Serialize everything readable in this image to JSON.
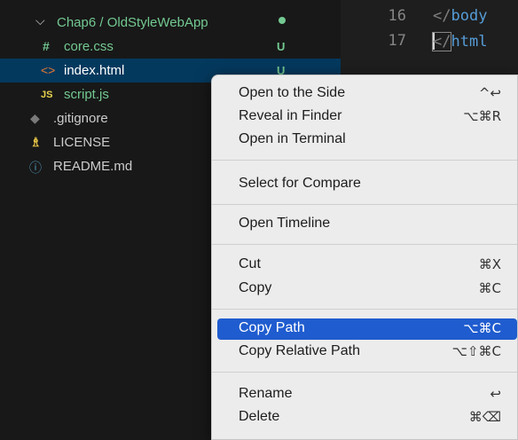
{
  "explorer": {
    "folder": {
      "label": "Chap6 / OldStyleWebApp",
      "dot_color": "#73c991"
    },
    "files": [
      {
        "icon": "#",
        "label": "core.css",
        "badge": "U"
      },
      {
        "icon": "<>",
        "label": "index.html",
        "badge": "U"
      },
      {
        "icon": "JS",
        "label": "script.js",
        "badge": ""
      },
      {
        "icon": "◆",
        "label": ".gitignore",
        "badge": ""
      },
      {
        "icon": "♗",
        "label": "LICENSE",
        "badge": ""
      },
      {
        "icon": "ⓘ",
        "label": "README.md",
        "badge": ""
      }
    ]
  },
  "editor": {
    "lines": [
      {
        "number": "16",
        "open": "</",
        "tag": "body"
      },
      {
        "number": "17",
        "open": "</",
        "tag": "html"
      }
    ]
  },
  "context_menu": {
    "items": [
      {
        "label": "Open to the Side",
        "shortcut": "^↩"
      },
      {
        "label": "Reveal in Finder",
        "shortcut": "⌥⌘R"
      },
      {
        "label": "Open in Terminal",
        "shortcut": ""
      },
      {
        "label": "Select for Compare",
        "shortcut": ""
      },
      {
        "label": "Open Timeline",
        "shortcut": ""
      },
      {
        "label": "Cut",
        "shortcut": "⌘X"
      },
      {
        "label": "Copy",
        "shortcut": "⌘C"
      },
      {
        "label": "Copy Path",
        "shortcut": "⌥⌘C"
      },
      {
        "label": "Copy Relative Path",
        "shortcut": "⌥⇧⌘C"
      },
      {
        "label": "Rename",
        "shortcut": "↩"
      },
      {
        "label": "Delete",
        "shortcut": "⌘⌫"
      }
    ],
    "active_item": "Copy Path"
  },
  "colors": {
    "accent": "#1f5ccf",
    "untracked": "#73c991",
    "selection": "#04395e"
  }
}
